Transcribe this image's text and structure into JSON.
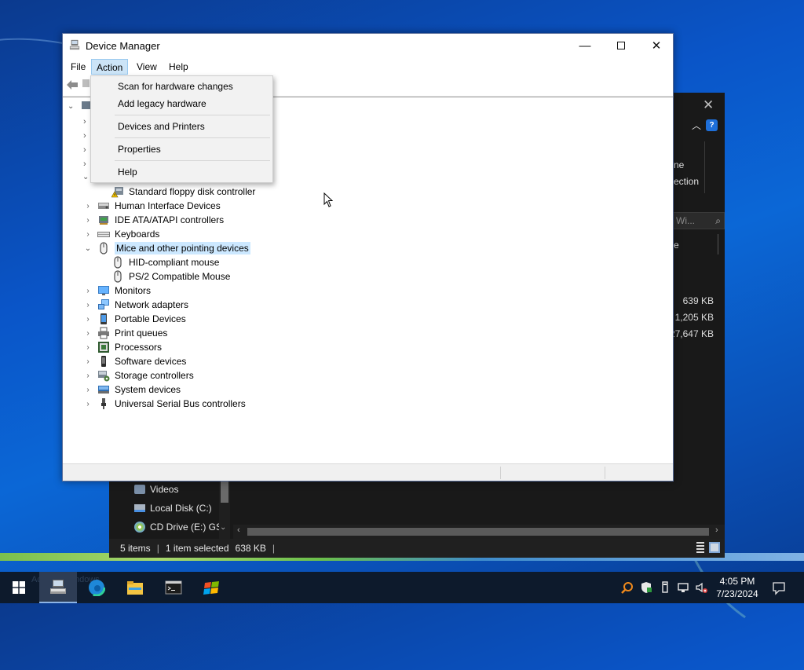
{
  "desktop": {
    "background_color": "#0a55c8"
  },
  "explorer": {
    "ribbon_fragment_1": "ne",
    "ribbon_fragment_2": "ection",
    "search_placeholder": "Wi...",
    "column_fragment": "e",
    "file_sizes": [
      "639 KB",
      "1,205 KB",
      "27,647 KB"
    ],
    "nav_items": [
      {
        "label": "Videos",
        "icon": "videos-folder-icon"
      },
      {
        "label": "Local Disk (C:)",
        "icon": "hard-drive-icon"
      },
      {
        "label": "CD Drive (E:) GSF",
        "icon": "cd-drive-icon"
      }
    ],
    "status_items_count": "5 items",
    "status_selected": "1 item selected",
    "status_selected_size": "638 KB",
    "help_label": "?"
  },
  "device_manager": {
    "title": "Device Manager",
    "menu": [
      "File",
      "Action",
      "View",
      "Help"
    ],
    "tree_rows": [
      {
        "label": "Standard floppy disk controller",
        "icon": "floppy-controller-warning-icon",
        "indent": 2,
        "expander": ""
      },
      {
        "label": "Human Interface Devices",
        "icon": "hid-icon",
        "indent": 1,
        "expander": "›"
      },
      {
        "label": "IDE ATA/ATAPI controllers",
        "icon": "ide-controller-icon",
        "indent": 1,
        "expander": "›"
      },
      {
        "label": "Keyboards",
        "icon": "keyboard-icon",
        "indent": 1,
        "expander": "›"
      },
      {
        "label": "Mice and other pointing devices",
        "icon": "mouse-icon",
        "indent": 1,
        "expander": "⌄",
        "selected": true
      },
      {
        "label": "HID-compliant mouse",
        "icon": "mouse-icon",
        "indent": 2,
        "expander": ""
      },
      {
        "label": "PS/2 Compatible Mouse",
        "icon": "mouse-icon",
        "indent": 2,
        "expander": ""
      },
      {
        "label": "Monitors",
        "icon": "monitor-icon",
        "indent": 1,
        "expander": "›"
      },
      {
        "label": "Network adapters",
        "icon": "network-adapter-icon",
        "indent": 1,
        "expander": "›"
      },
      {
        "label": "Portable Devices",
        "icon": "portable-device-icon",
        "indent": 1,
        "expander": "›"
      },
      {
        "label": "Print queues",
        "icon": "printer-icon",
        "indent": 1,
        "expander": "›"
      },
      {
        "label": "Processors",
        "icon": "processor-icon",
        "indent": 1,
        "expander": "›"
      },
      {
        "label": "Software devices",
        "icon": "software-device-icon",
        "indent": 1,
        "expander": "›"
      },
      {
        "label": "Storage controllers",
        "icon": "storage-controller-icon",
        "indent": 1,
        "expander": "›"
      },
      {
        "label": "System devices",
        "icon": "system-device-icon",
        "indent": 1,
        "expander": "›"
      },
      {
        "label": "Universal Serial Bus controllers",
        "icon": "usb-icon",
        "indent": 1,
        "expander": "›"
      }
    ]
  },
  "action_menu": {
    "items": [
      "Scan for hardware changes",
      "Add legacy hardware",
      "Devices and Printers",
      "Properties",
      "Help"
    ]
  },
  "taskbar": {
    "time": "4:05 PM",
    "date": "7/23/2024",
    "ghost_text": "Activate Windows",
    "apps": [
      "start-icon",
      "device-manager-app-icon",
      "edge-icon",
      "file-explorer-icon",
      "terminal-icon",
      "windows-flag-icon"
    ]
  }
}
